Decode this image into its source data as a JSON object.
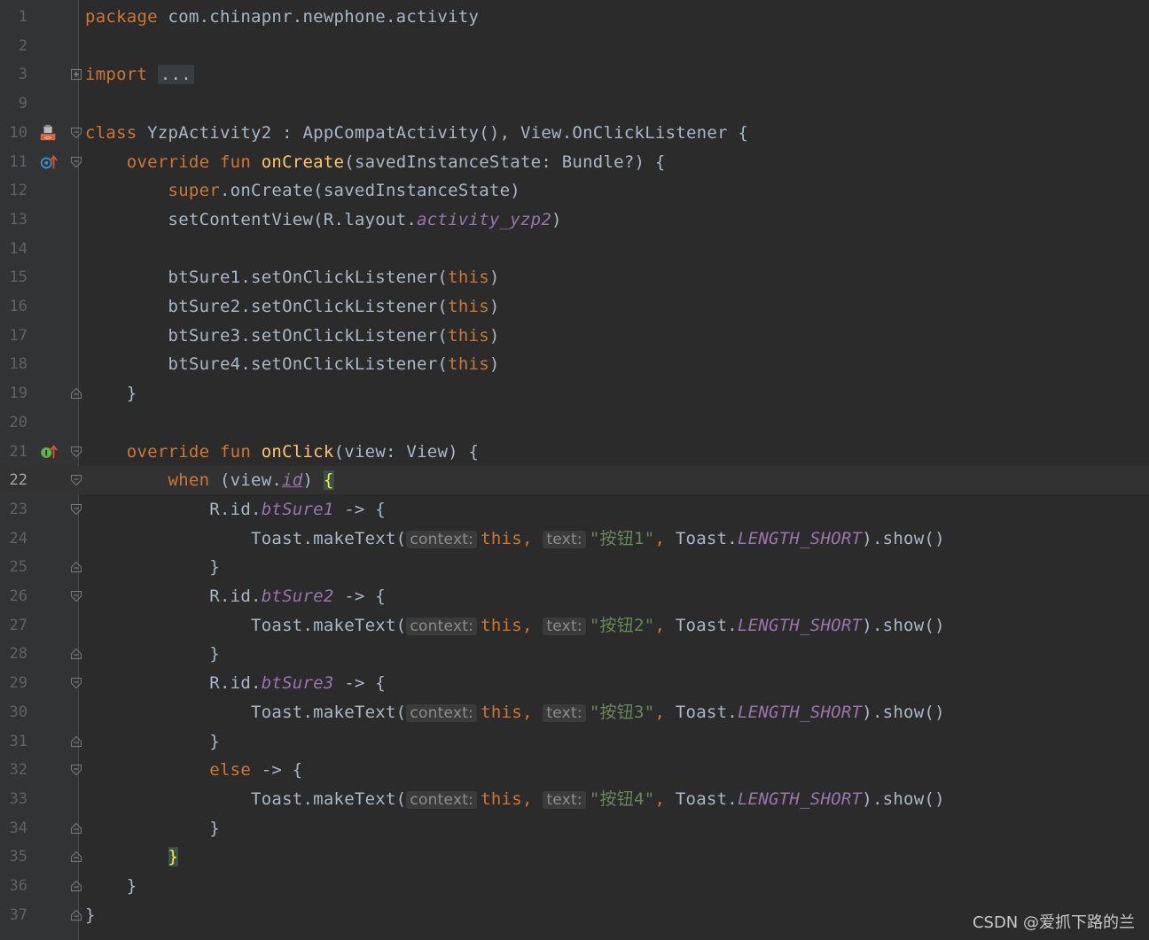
{
  "editor": {
    "current_line": 22,
    "lines": [
      {
        "n": "1",
        "tokens": [
          [
            "kw",
            "package"
          ],
          [
            "plain",
            " com.chinapnr.newphone.activity"
          ]
        ]
      },
      {
        "n": "2",
        "tokens": []
      },
      {
        "n": "3",
        "fold": "plus",
        "tokens": [
          [
            "kw",
            "import"
          ],
          [
            "plain",
            " "
          ],
          [
            "fold",
            "..."
          ]
        ]
      },
      {
        "n": "9",
        "tokens": []
      },
      {
        "n": "10",
        "fold": "open",
        "icon": "class-layout-icon",
        "tokens": [
          [
            "kw",
            "class"
          ],
          [
            "plain",
            " YzpActivity2 : AppCompatActivity(), View.OnClickListener {"
          ]
        ]
      },
      {
        "n": "11",
        "fold": "open",
        "icon": "override-method-icon",
        "tokens": [
          [
            "plain",
            "    "
          ],
          [
            "kw",
            "override fun "
          ],
          [
            "fn",
            "onCreate"
          ],
          [
            "plain",
            "(savedInstanceState: Bundle?) {"
          ]
        ]
      },
      {
        "n": "12",
        "tokens": [
          [
            "plain",
            "        "
          ],
          [
            "kw",
            "super"
          ],
          [
            "plain",
            ".onCreate(savedInstanceState)"
          ]
        ]
      },
      {
        "n": "13",
        "tokens": [
          [
            "plain",
            "        setContentView(R.layout."
          ],
          [
            "field",
            "activity_yzp2"
          ],
          [
            "plain",
            ")"
          ]
        ]
      },
      {
        "n": "14",
        "tokens": []
      },
      {
        "n": "15",
        "tokens": [
          [
            "plain",
            "        btSure1.setOnClickListener("
          ],
          [
            "kw",
            "this"
          ],
          [
            "plain",
            ")"
          ]
        ]
      },
      {
        "n": "16",
        "tokens": [
          [
            "plain",
            "        btSure2.setOnClickListener("
          ],
          [
            "kw",
            "this"
          ],
          [
            "plain",
            ")"
          ]
        ]
      },
      {
        "n": "17",
        "tokens": [
          [
            "plain",
            "        btSure3.setOnClickListener("
          ],
          [
            "kw",
            "this"
          ],
          [
            "plain",
            ")"
          ]
        ]
      },
      {
        "n": "18",
        "tokens": [
          [
            "plain",
            "        btSure4.setOnClickListener("
          ],
          [
            "kw",
            "this"
          ],
          [
            "plain",
            ")"
          ]
        ]
      },
      {
        "n": "19",
        "fold": "end",
        "tokens": [
          [
            "plain",
            "    }"
          ]
        ]
      },
      {
        "n": "20",
        "tokens": []
      },
      {
        "n": "21",
        "fold": "open",
        "icon": "implement-method-icon",
        "tokens": [
          [
            "plain",
            "    "
          ],
          [
            "kw",
            "override fun "
          ],
          [
            "fn",
            "onClick"
          ],
          [
            "plain",
            "(view: View) {"
          ]
        ]
      },
      {
        "n": "22",
        "fold": "open",
        "tokens": [
          [
            "plain",
            "        "
          ],
          [
            "kw",
            "when"
          ],
          [
            "plain",
            " (view."
          ],
          [
            "ul",
            "id"
          ],
          [
            "plain",
            ") "
          ],
          [
            "brace",
            "{"
          ]
        ]
      },
      {
        "n": "23",
        "fold": "open",
        "tokens": [
          [
            "plain",
            "            R.id."
          ],
          [
            "field",
            "btSure1"
          ],
          [
            "plain",
            " -> {"
          ]
        ]
      },
      {
        "n": "24",
        "tokens": [
          [
            "plain",
            "                Toast.makeText("
          ],
          [
            "hint",
            "context:"
          ],
          [
            "kw",
            "this"
          ],
          [
            "kw",
            ", "
          ],
          [
            "hint",
            "text:"
          ],
          [
            "str",
            "\"按钮1\""
          ],
          [
            "kw",
            ", "
          ],
          [
            "plain",
            "Toast."
          ],
          [
            "field",
            "LENGTH_SHORT"
          ],
          [
            "plain",
            ").show()"
          ]
        ]
      },
      {
        "n": "25",
        "fold": "end",
        "tokens": [
          [
            "plain",
            "            }"
          ]
        ]
      },
      {
        "n": "26",
        "fold": "open",
        "tokens": [
          [
            "plain",
            "            R.id."
          ],
          [
            "field",
            "btSure2"
          ],
          [
            "plain",
            " -> {"
          ]
        ]
      },
      {
        "n": "27",
        "tokens": [
          [
            "plain",
            "                Toast.makeText("
          ],
          [
            "hint",
            "context:"
          ],
          [
            "kw",
            "this"
          ],
          [
            "kw",
            ", "
          ],
          [
            "hint",
            "text:"
          ],
          [
            "str",
            "\"按钮2\""
          ],
          [
            "kw",
            ", "
          ],
          [
            "plain",
            "Toast."
          ],
          [
            "field",
            "LENGTH_SHORT"
          ],
          [
            "plain",
            ").show()"
          ]
        ]
      },
      {
        "n": "28",
        "fold": "end",
        "tokens": [
          [
            "plain",
            "            }"
          ]
        ]
      },
      {
        "n": "29",
        "fold": "open",
        "tokens": [
          [
            "plain",
            "            R.id."
          ],
          [
            "field",
            "btSure3"
          ],
          [
            "plain",
            " -> {"
          ]
        ]
      },
      {
        "n": "30",
        "tokens": [
          [
            "plain",
            "                Toast.makeText("
          ],
          [
            "hint",
            "context:"
          ],
          [
            "kw",
            "this"
          ],
          [
            "kw",
            ", "
          ],
          [
            "hint",
            "text:"
          ],
          [
            "str",
            "\"按钮3\""
          ],
          [
            "kw",
            ", "
          ],
          [
            "plain",
            "Toast."
          ],
          [
            "field",
            "LENGTH_SHORT"
          ],
          [
            "plain",
            ").show()"
          ]
        ]
      },
      {
        "n": "31",
        "fold": "end",
        "tokens": [
          [
            "plain",
            "            }"
          ]
        ]
      },
      {
        "n": "32",
        "fold": "open",
        "tokens": [
          [
            "plain",
            "            "
          ],
          [
            "kw",
            "else"
          ],
          [
            "plain",
            " -> {"
          ]
        ]
      },
      {
        "n": "33",
        "tokens": [
          [
            "plain",
            "                Toast.makeText("
          ],
          [
            "hint",
            "context:"
          ],
          [
            "kw",
            "this"
          ],
          [
            "kw",
            ", "
          ],
          [
            "hint",
            "text:"
          ],
          [
            "str",
            "\"按钮4\""
          ],
          [
            "kw",
            ", "
          ],
          [
            "plain",
            "Toast."
          ],
          [
            "field",
            "LENGTH_SHORT"
          ],
          [
            "plain",
            ").show()"
          ]
        ]
      },
      {
        "n": "34",
        "fold": "end",
        "tokens": [
          [
            "plain",
            "            }"
          ]
        ]
      },
      {
        "n": "35",
        "fold": "end",
        "tokens": [
          [
            "plain",
            "        "
          ],
          [
            "brace",
            "}"
          ]
        ]
      },
      {
        "n": "36",
        "fold": "end",
        "tokens": [
          [
            "plain",
            "    }"
          ]
        ]
      },
      {
        "n": "37",
        "fold": "end",
        "tokens": [
          [
            "plain",
            "}"
          ]
        ]
      }
    ]
  },
  "colors": {
    "background": "#2b2b2b",
    "gutter": "#313335",
    "keyword": "#cc7832",
    "function": "#ffc66d",
    "field": "#9876aa",
    "string": "#6a8759",
    "text": "#a9b7c6"
  },
  "watermark": "CSDN @爱抓下路的兰"
}
